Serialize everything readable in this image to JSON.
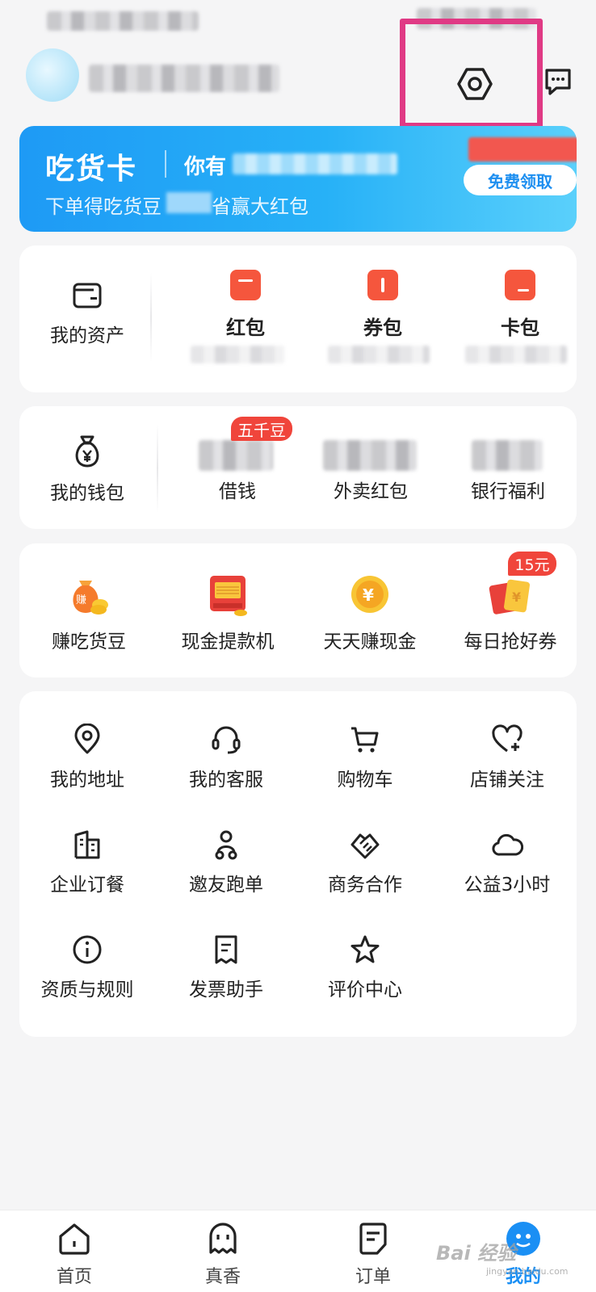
{
  "header": {
    "settings_icon": "settings-hexagon-icon",
    "message_icon": "message-icon"
  },
  "banner": {
    "title": "吃货卡",
    "greeting_prefix": "你有",
    "subtitle": "下单得吃货豆",
    "subtitle_tail": "省赢大红包",
    "button_label": "免费领取"
  },
  "assets": {
    "main_label": "我的资产",
    "items": [
      {
        "title": "红包",
        "icon": "red-envelope-icon"
      },
      {
        "title": "券包",
        "icon": "coupon-icon"
      },
      {
        "title": "卡包",
        "icon": "card-icon"
      }
    ]
  },
  "wallet": {
    "main_label": "我的钱包",
    "badge": "五千豆",
    "items": [
      {
        "label": "借钱"
      },
      {
        "label": "外卖红包"
      },
      {
        "label": "银行福利"
      }
    ]
  },
  "promos": {
    "badge": "15元",
    "items": [
      {
        "label": "赚吃货豆",
        "icon": "bean-bag-icon"
      },
      {
        "label": "现金提款机",
        "icon": "cash-machine-icon"
      },
      {
        "label": "天天赚现金",
        "icon": "gold-coin-icon"
      },
      {
        "label": "每日抢好券",
        "icon": "coupon-gift-icon"
      }
    ]
  },
  "tools": {
    "items": [
      {
        "label": "我的地址",
        "icon": "location-pin-icon"
      },
      {
        "label": "我的客服",
        "icon": "headset-icon"
      },
      {
        "label": "购物车",
        "icon": "shopping-cart-icon"
      },
      {
        "label": "店铺关注",
        "icon": "heart-plus-icon"
      },
      {
        "label": "企业订餐",
        "icon": "building-icon"
      },
      {
        "label": "邀友跑单",
        "icon": "rider-icon"
      },
      {
        "label": "商务合作",
        "icon": "handshake-icon"
      },
      {
        "label": "公益3小时",
        "icon": "cloud-icon"
      },
      {
        "label": "资质与规则",
        "icon": "info-icon"
      },
      {
        "label": "发票助手",
        "icon": "receipt-icon"
      },
      {
        "label": "评价中心",
        "icon": "star-icon"
      }
    ]
  },
  "tabbar": {
    "items": [
      {
        "label": "首页",
        "icon": "home-icon",
        "active": false
      },
      {
        "label": "真香",
        "icon": "ghost-face-icon",
        "active": false
      },
      {
        "label": "订单",
        "icon": "order-icon",
        "active": false
      },
      {
        "label": "我的",
        "icon": "mine-avatar-icon",
        "active": true
      }
    ]
  },
  "watermark": {
    "text": "Bai 经验",
    "sub": "jingyan.baidu.com"
  },
  "colors": {
    "accent_blue": "#1a8ff4",
    "badge_red": "#f0453b",
    "highlight_pink": "#e03a85"
  }
}
